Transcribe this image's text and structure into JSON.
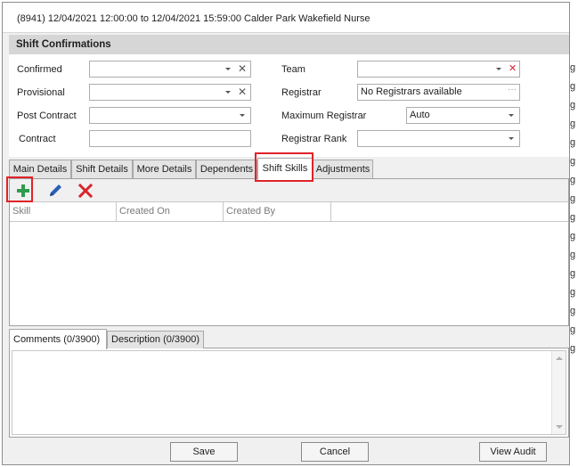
{
  "window": {
    "title": "(8941) 12/04/2021 12:00:00 to 12/04/2021 15:59:00 Calder Park Wakefield Nurse"
  },
  "section": {
    "heading": "Shift Confirmations"
  },
  "form": {
    "confirmed": {
      "label": "Confirmed",
      "value": ""
    },
    "provisional": {
      "label": "Provisional",
      "value": ""
    },
    "post_contract": {
      "label": "Post Contract",
      "value": ""
    },
    "contract": {
      "label": "Contract",
      "value": ""
    },
    "team": {
      "label": "Team",
      "value": ""
    },
    "registrar": {
      "label": "Registrar",
      "value": "No Registrars available"
    },
    "maximum_registrar": {
      "label": "Maximum Registrar",
      "value": "Auto"
    },
    "registrar_rank": {
      "label": "Registrar Rank",
      "value": ""
    }
  },
  "tabs": [
    {
      "label": "Main Details"
    },
    {
      "label": "Shift Details"
    },
    {
      "label": "More Details"
    },
    {
      "label": "Dependents"
    },
    {
      "label": "Shift Skills",
      "active": true
    },
    {
      "label": "Adjustments"
    }
  ],
  "toolbar": {
    "add_icon": "plus-icon",
    "edit_icon": "pencil-icon",
    "delete_icon": "x-icon"
  },
  "grid": {
    "columns": [
      "Skill",
      "Created On",
      "Created By"
    ],
    "rows": []
  },
  "comment_tabs": [
    {
      "label": "Comments (0/3900)",
      "active": true
    },
    {
      "label": "Description (0/3900)"
    }
  ],
  "comments": {
    "value": ""
  },
  "buttons": {
    "save": "Save",
    "cancel": "Cancel",
    "view_audit": "View Audit"
  },
  "background_strip": {
    "glyphs": [
      "g",
      "g",
      "g",
      "g",
      "g",
      "g",
      "g",
      "g",
      "g",
      "g",
      "g",
      "g",
      "g",
      "g",
      "g",
      "g"
    ]
  },
  "colors": {
    "highlight": "#e02229",
    "add_green": "#2e9b4f",
    "edit_blue": "#2a5fb8",
    "delete_red": "#d8242a"
  }
}
